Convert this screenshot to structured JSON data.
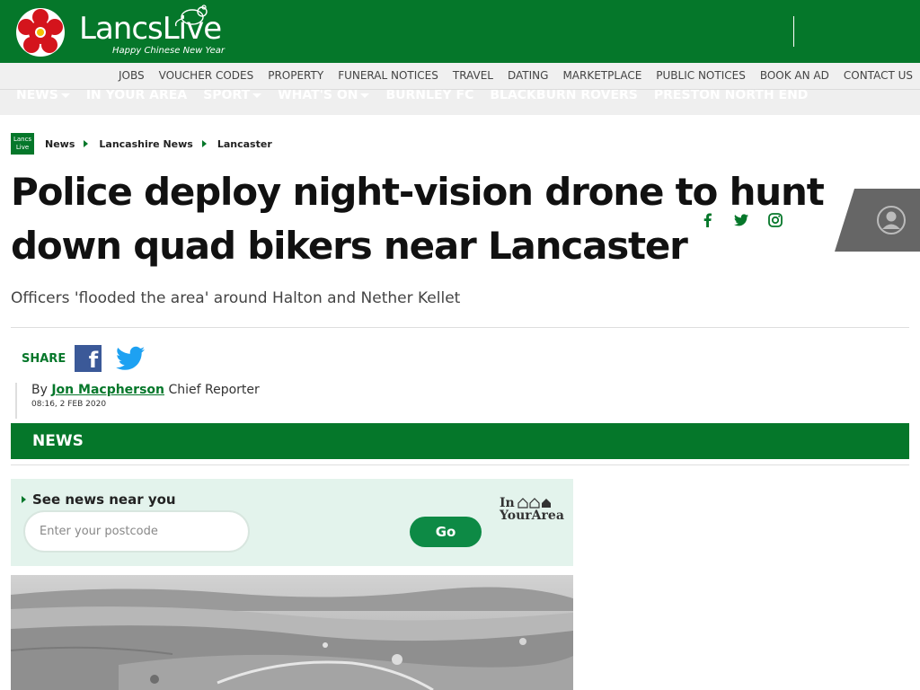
{
  "brand": {
    "name_main": "Lancs",
    "name_accent": "Live",
    "tagline": "Happy Chinese New Year"
  },
  "colors": {
    "brand_green": "#05772a",
    "go_green": "#0d8a45",
    "nearyou_bg": "#e3f3ec",
    "facebook_blue": "#3b5998",
    "twitter_blue": "#1da1f2"
  },
  "util_nav": [
    "JOBS",
    "VOUCHER CODES",
    "PROPERTY",
    "FUNERAL NOTICES",
    "TRAVEL",
    "DATING",
    "MARKETPLACE",
    "PUBLIC NOTICES",
    "BOOK AN AD",
    "CONTACT US"
  ],
  "main_nav": [
    {
      "label": "NEWS",
      "dropdown": true
    },
    {
      "label": "IN YOUR AREA",
      "dropdown": false
    },
    {
      "label": "SPORT",
      "dropdown": true
    },
    {
      "label": "WHAT'S ON",
      "dropdown": true
    },
    {
      "label": "BURNLEY FC",
      "dropdown": false
    },
    {
      "label": "BLACKBURN ROVERS",
      "dropdown": false
    },
    {
      "label": "PRESTON NORTH END",
      "dropdown": false
    }
  ],
  "breadcrumb": {
    "logo_line1": "Lancs",
    "logo_line2": "Live",
    "items": [
      "News",
      "Lancashire News",
      "Lancaster"
    ]
  },
  "article": {
    "headline": "Police deploy night-vision drone to hunt down quad bikers near Lancaster",
    "standfirst": "Officers 'flooded the area' around Halton and Nether Kellet",
    "share_label": "SHARE",
    "by_prefix": "By",
    "author": "Jon Macpherson",
    "author_role": "Chief Reporter",
    "timestamp": "08:16, 2 FEB 2020",
    "section_band": "NEWS"
  },
  "social_icons": [
    "facebook-icon",
    "twitter-icon",
    "instagram-icon"
  ],
  "near_you": {
    "title": "See news near you",
    "placeholder": "Enter your postcode",
    "button": "Go",
    "logo_line1": "In",
    "logo_line2": "YourArea"
  }
}
